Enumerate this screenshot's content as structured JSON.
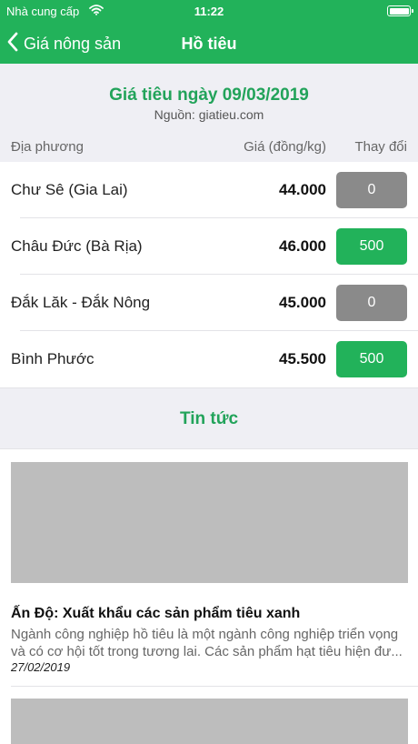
{
  "status_bar": {
    "carrier": "Nhà cung cấp",
    "time": "11:22",
    "icons": [
      "wifi-icon",
      "battery-icon"
    ],
    "battery_level": 1.0
  },
  "nav": {
    "back_label": "Giá nông sản",
    "back_icon": "chevron-left-icon",
    "title": "Hồ tiêu"
  },
  "price_section": {
    "title": "Giá tiêu ngày 09/03/2019",
    "source": "Nguồn: giatieu.com",
    "headers": {
      "location": "Địa phương",
      "price": "Giá (đồng/kg)",
      "change": "Thay đổi"
    },
    "rows": [
      {
        "location": "Chư Sê (Gia Lai)",
        "price": "44.000",
        "change": "0",
        "change_color": "#8a8a8a"
      },
      {
        "location": "Châu Đức (Bà Rịa)",
        "price": "46.000",
        "change": "500",
        "change_color": "#22b25a"
      },
      {
        "location": "Đắk Lăk - Đắk Nông",
        "price": "45.000",
        "change": "0",
        "change_color": "#8a8a8a"
      },
      {
        "location": "Bình Phước",
        "price": "45.500",
        "change": "500",
        "change_color": "#22b25a"
      }
    ]
  },
  "news": {
    "heading": "Tin tức",
    "items": [
      {
        "title": "Ấn Độ: Xuất khẩu các sản phẩm tiêu xanh",
        "summary_line1": "Ngành công nghiệp hồ tiêu là một ngành công nghiệp triển vọng",
        "summary_line2": "và có cơ hội tốt trong tương lai. Các sản phẩm hạt tiêu hiện đư...",
        "date": "27/02/2019"
      }
    ]
  },
  "colors": {
    "accent": "#22b25a",
    "accent_text": "#22a35a",
    "background_gray": "#efeff4",
    "zero_change": "#8a8a8a",
    "image_placeholder": "#bdbdbd"
  }
}
